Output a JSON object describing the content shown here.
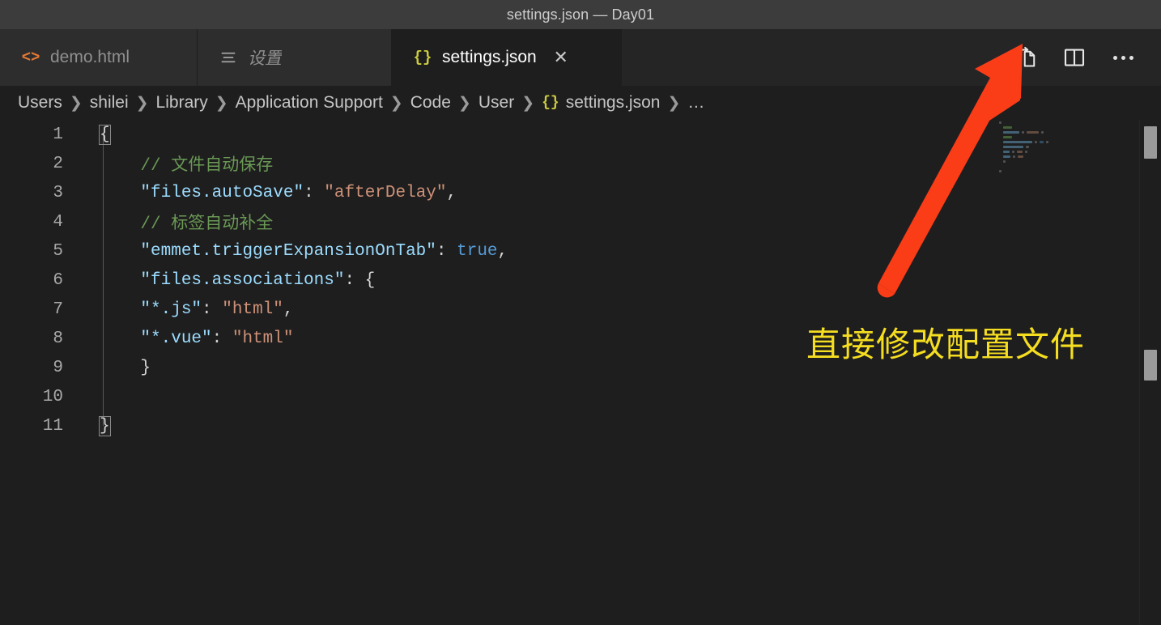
{
  "window": {
    "title": "settings.json — Day01"
  },
  "tabs": [
    {
      "label": "demo.html",
      "icon": "html-file-icon",
      "icon_glyph": "<>",
      "active": false,
      "preview": false,
      "closable": false
    },
    {
      "label": "设置",
      "icon": "settings-ui-icon",
      "icon_glyph": "≡",
      "active": false,
      "preview": true,
      "closable": false
    },
    {
      "label": "settings.json",
      "icon": "json-file-icon",
      "icon_glyph": "{}",
      "active": true,
      "preview": false,
      "closable": true,
      "close_glyph": "✕"
    }
  ],
  "tab_actions": [
    {
      "name": "open-settings-json-button",
      "tooltip": "Open Settings (JSON)"
    },
    {
      "name": "split-editor-button",
      "tooltip": "Split Editor"
    },
    {
      "name": "more-actions-button",
      "tooltip": "More Actions..."
    }
  ],
  "breadcrumb": {
    "separator": "❯",
    "items": [
      {
        "label": "Users",
        "icon": null
      },
      {
        "label": "shilei",
        "icon": null
      },
      {
        "label": "Library",
        "icon": null
      },
      {
        "label": "Application Support",
        "icon": null
      },
      {
        "label": "Code",
        "icon": null
      },
      {
        "label": "User",
        "icon": null
      },
      {
        "label": "settings.json",
        "icon": "json-file-icon",
        "icon_glyph": "{}"
      },
      {
        "label": "…",
        "icon": null
      }
    ]
  },
  "editor": {
    "language": "jsonc",
    "total_lines": 11,
    "lines": [
      {
        "n": "1",
        "tokens": [
          {
            "t": "{",
            "k": "brace-match"
          }
        ]
      },
      {
        "n": "2",
        "tokens": [
          {
            "t": "    ",
            "k": "plain"
          },
          {
            "t": "// 文件自动保存",
            "k": "comment"
          }
        ]
      },
      {
        "n": "3",
        "tokens": [
          {
            "t": "    ",
            "k": "plain"
          },
          {
            "t": "\"files.autoSave\"",
            "k": "key"
          },
          {
            "t": ": ",
            "k": "punc"
          },
          {
            "t": "\"afterDelay\"",
            "k": "str"
          },
          {
            "t": ",",
            "k": "punc"
          }
        ]
      },
      {
        "n": "4",
        "tokens": [
          {
            "t": "    ",
            "k": "plain"
          },
          {
            "t": "// 标签自动补全",
            "k": "comment"
          }
        ]
      },
      {
        "n": "5",
        "tokens": [
          {
            "t": "    ",
            "k": "plain"
          },
          {
            "t": "\"emmet.triggerExpansionOnTab\"",
            "k": "key"
          },
          {
            "t": ": ",
            "k": "punc"
          },
          {
            "t": "true",
            "k": "bool"
          },
          {
            "t": ",",
            "k": "punc"
          }
        ]
      },
      {
        "n": "6",
        "tokens": [
          {
            "t": "    ",
            "k": "plain"
          },
          {
            "t": "\"files.associations\"",
            "k": "key"
          },
          {
            "t": ": {",
            "k": "punc"
          }
        ]
      },
      {
        "n": "7",
        "tokens": [
          {
            "t": "    ",
            "k": "plain"
          },
          {
            "t": "\"*.js\"",
            "k": "key"
          },
          {
            "t": ": ",
            "k": "punc"
          },
          {
            "t": "\"html\"",
            "k": "str"
          },
          {
            "t": ",",
            "k": "punc"
          }
        ]
      },
      {
        "n": "8",
        "tokens": [
          {
            "t": "    ",
            "k": "plain"
          },
          {
            "t": "\"*.vue\"",
            "k": "key"
          },
          {
            "t": ": ",
            "k": "punc"
          },
          {
            "t": "\"html\"",
            "k": "str"
          }
        ]
      },
      {
        "n": "9",
        "tokens": [
          {
            "t": "    ",
            "k": "plain"
          },
          {
            "t": "}",
            "k": "punc"
          }
        ]
      },
      {
        "n": "10",
        "tokens": []
      },
      {
        "n": "11",
        "tokens": [
          {
            "t": "}",
            "k": "brace-match"
          }
        ]
      }
    ]
  },
  "annotation": {
    "text": "直接修改配置文件",
    "text_color": "#f5dd20",
    "arrow_color": "#fa3c17"
  },
  "colors": {
    "editor_background": "#1e1e1e",
    "tabbar_background": "#252526",
    "inactive_tab_background": "#2d2d2d",
    "titlebar_background": "#3c3c3c",
    "comment": "#6a9955",
    "key": "#9cdcfe",
    "string": "#ce9178",
    "boolean": "#569cd6",
    "foreground": "#d4d4d4",
    "line_number": "#a8a8a8",
    "json_icon": "#cbcb41",
    "html_icon": "#e37933",
    "scrollbar": "#9a9a9a"
  }
}
